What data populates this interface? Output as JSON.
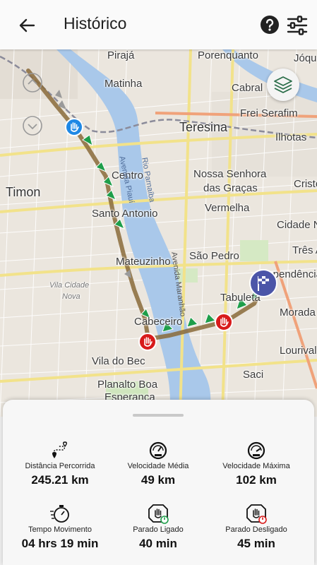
{
  "header": {
    "title": "Histórico",
    "back_icon": "arrow-left-icon",
    "help_icon": "help-circle-icon",
    "filter_icon": "sliders-icon"
  },
  "map": {
    "labels": {
      "piraja": "Pirajá",
      "porenquanto": "Porenquanto",
      "joque": "Jóque",
      "matinha": "Matinha",
      "cabral": "Cabral",
      "frei_serafim": "Frei Serafim",
      "ilhotas": "Ilhotas",
      "teresina": "Teresina",
      "centro": "Centro",
      "timon": "Timon",
      "nossa_senhora": "Nossa Senhora",
      "das_gracas": "das Graças",
      "cristo": "Cristo",
      "santo_antonio": "Santo Antonio",
      "vermelha": "Vermelha",
      "cidade_nova": "Cidade N",
      "tres_andares": "Três A",
      "mateuzinho": "Mateuzinho",
      "sao_pedro": "São Pedro",
      "independencia": "dependência",
      "vila_cidade": "Vila Cidade",
      "nova": "Nova",
      "tabuleta": "Tabuleta",
      "morada": "Morada",
      "cabeceiro": "Cabeceiro",
      "lourival": "Lourival",
      "vila_do_bec": "Vila do Bec",
      "saci": "Saci",
      "planalto_boa": "Planalto Boa",
      "esperanca": "Esperança",
      "avenida_piaui": "Avenida Piauí",
      "avenida_maranhao": "Avenida Maranhão",
      "rio_parnaiba": "Rio Parnaíba"
    },
    "markers": {
      "start": "hand-stop-blue-icon",
      "stops": "hand-stop-red-icon",
      "end": "finish-flag-icon"
    },
    "layers_icon": "layers-icon"
  },
  "stats": [
    {
      "icon": "route-distance-icon",
      "label": "Distância Percorrida",
      "value": "245.21 km"
    },
    {
      "icon": "speedometer-icon",
      "label": "Velocidade Média",
      "value": "49 km"
    },
    {
      "icon": "speedometer-max-icon",
      "label": "Velocidade Máxima",
      "value": "102 km"
    },
    {
      "icon": "stopwatch-icon",
      "label": "Tempo Movimento",
      "value": "04 hrs 19 min"
    },
    {
      "icon": "hand-stop-on-icon",
      "label": "Parado Ligado",
      "value": "40 min"
    },
    {
      "icon": "hand-stop-off-icon",
      "label": "Parado Desligado",
      "value": "45 min"
    }
  ],
  "colors": {
    "route": "#8a6a3a",
    "arrow_green": "#1e9e4a",
    "arrow_gray": "#9a9a9a",
    "stop_red": "#d81b1b",
    "start_blue": "#1e88e5",
    "flag_purple": "#4b55a8",
    "river": "#a9c8ea"
  }
}
